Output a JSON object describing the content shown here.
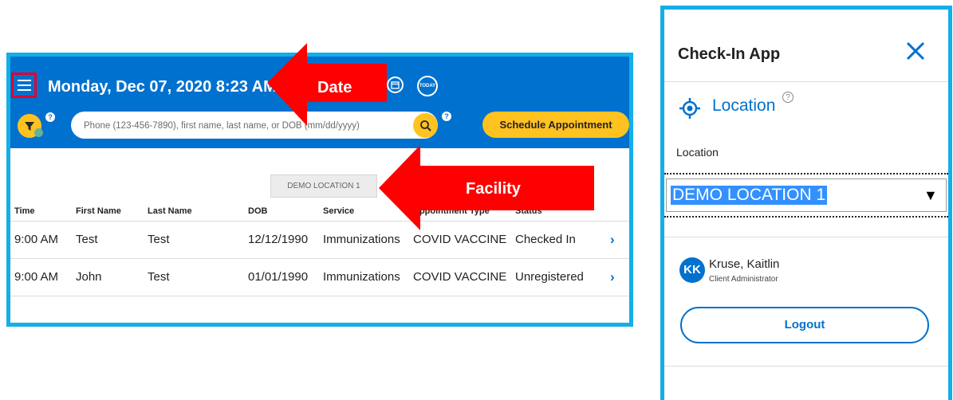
{
  "header": {
    "date_time": "Monday, Dec 07, 2020 8:23 AM",
    "today_label": "TODAY",
    "help_label": "?"
  },
  "search": {
    "placeholder": "Phone (123-456-7890), first name, last name, or DOB (mm/dd/yyyy)"
  },
  "toolbar": {
    "schedule_label": "Schedule Appointment"
  },
  "location_chip": "DEMO LOCATION 1",
  "table": {
    "columns": [
      "Time",
      "First Name",
      "Last Name",
      "DOB",
      "Service",
      "Appointment Type",
      "Status"
    ],
    "rows": [
      [
        "9:00 AM",
        "Test",
        "Test",
        "12/12/1990",
        "Immunizations",
        "COVID VACCINE",
        "Checked In"
      ],
      [
        "9:00 AM",
        "John",
        "Test",
        "01/01/1990",
        "Immunizations",
        "COVID VACCINE",
        "Unregistered"
      ]
    ]
  },
  "annotations": {
    "date_label": "Date",
    "facility_label": "Facility",
    "arrow_color": "#ff0000"
  },
  "side_panel": {
    "title": "Check-In App",
    "location_heading": "Location",
    "location_help": "?",
    "location_field_label": "Location",
    "location_value": "DEMO LOCATION 1",
    "user": {
      "initials": "KK",
      "name": "Kruse, Kaitlin",
      "role": "Client Administrator"
    },
    "logout_label": "Logout"
  },
  "colors": {
    "brand_blue": "#0071ce",
    "accent_yellow": "#ffc220",
    "frame_cyan": "#14aee8",
    "menu_highlight": "#e4002b"
  }
}
